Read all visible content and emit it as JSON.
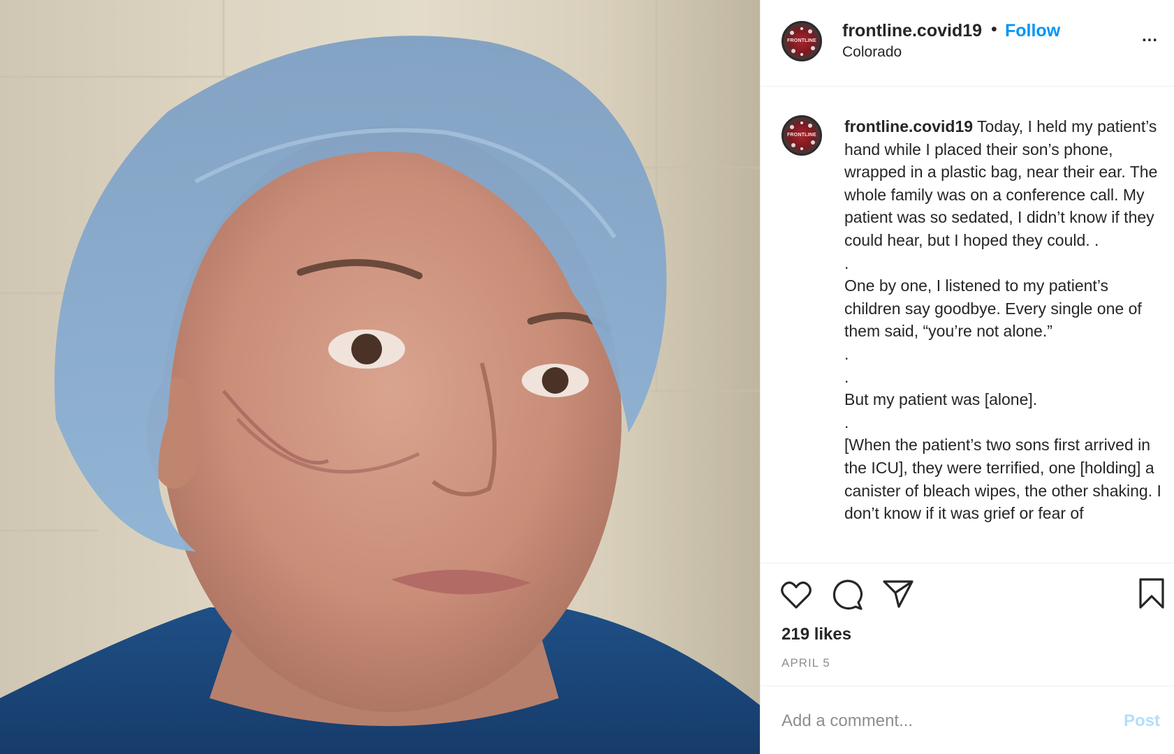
{
  "post": {
    "username": "frontline.covid19",
    "location": "Colorado",
    "follow_label": "Follow",
    "separator": "•",
    "more_label": "...",
    "avatar_text": "FRONTLINE"
  },
  "caption": {
    "username": "frontline.covid19",
    "text": " Today, I held my patient’s hand while I placed their son’s phone, wrapped in a plastic bag, near their ear. The whole family was on a conference call. My patient was so sedated, I didn’t know if they could hear, but I hoped they could. .\n.\nOne by one, I listened to my patient’s children say goodbye. Every single one of them said, “you’re not alone.”\n.\n.\nBut my patient was [alone].\n.\n[When the patient’s two sons first arrived in the ICU], they were terrified, one [holding] a canister of bleach wipes, the other shaking. I don’t know if it was grief or fear of"
  },
  "actions": {
    "like_icon": "heart-icon",
    "comment_icon": "comment-bubble-icon",
    "share_icon": "paper-plane-icon",
    "save_icon": "bookmark-icon",
    "likes": "219 likes",
    "date": "APRIL 5"
  },
  "comment": {
    "placeholder": "Add a comment...",
    "post_label": "Post"
  },
  "colors": {
    "link_blue": "#0095f6",
    "post_disabled": "#b2dffc",
    "border": "#efefef",
    "secondary_text": "#8e8e8e"
  }
}
